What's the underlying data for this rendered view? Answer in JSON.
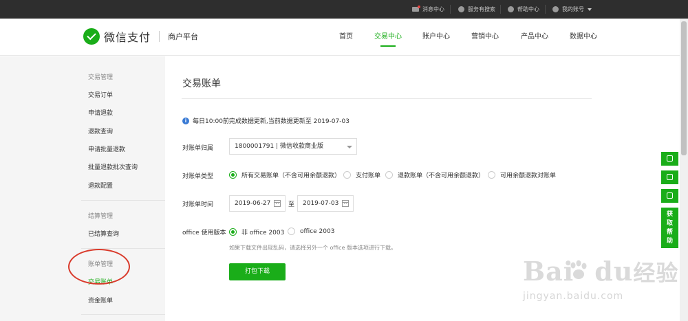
{
  "topbar": {
    "messages": "消息中心",
    "search": "服务有搜索",
    "help": "帮助中心",
    "account": "我的账号"
  },
  "header": {
    "brand": "微信支付",
    "platform": "商户平台",
    "nav": [
      {
        "label": "首页"
      },
      {
        "label": "交易中心"
      },
      {
        "label": "账户中心"
      },
      {
        "label": "营销中心"
      },
      {
        "label": "产品中心"
      },
      {
        "label": "数据中心"
      }
    ]
  },
  "sidebar": {
    "sections": [
      {
        "title": "交易管理",
        "items": [
          "交易订单",
          "申请退款",
          "退款查询",
          "申请批量退款",
          "批量退款批次查询",
          "退款配置"
        ]
      },
      {
        "title": "结算管理",
        "items": [
          "已结算查询"
        ]
      },
      {
        "title": "账单管理",
        "items": [
          "交易账单",
          "资金账单"
        ]
      }
    ]
  },
  "main": {
    "title": "交易账单",
    "info": "每日10:00前完成数据更新,当前数据更新至 2019-07-03",
    "account_label": "对账单归属",
    "account_value": "1800001791 | 微信收款商业版",
    "type_label": "对账单类型",
    "types": [
      "所有交易账单（不含可用余额退款）",
      "支付账单",
      "退款账单（不含可用余额退款）",
      "可用余额退款对账单"
    ],
    "time_label": "对账单时间",
    "date_from": "2019-06-27",
    "date_sep": "至",
    "date_to": "2019-07-03",
    "office_label": "office 使用版本",
    "office_options": [
      "非 office 2003",
      "office 2003"
    ],
    "hint": "如果下载文件出现乱码，请选择另外一个 office 版本选项进行下载。",
    "download": "打包下载"
  },
  "float": {
    "help": "获取帮助"
  },
  "watermark": {
    "main": "Bai",
    "main2": "du",
    "jingyan": "经验",
    "url": "jingyan.baidu.com"
  },
  "colors": {
    "accent": "#1aad19",
    "topbar": "#2e2e2e",
    "annotation": "#d93a2b"
  }
}
